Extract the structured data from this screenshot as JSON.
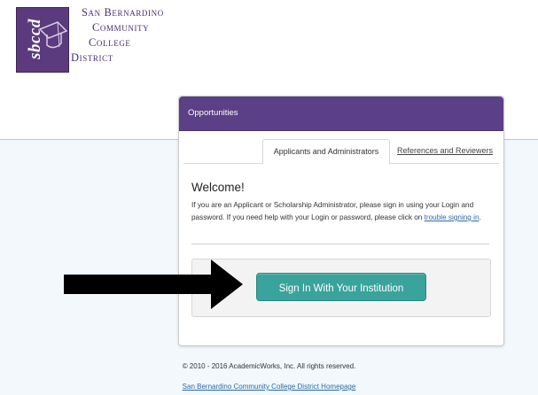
{
  "logo": {
    "monogram": "sbccd",
    "lines": [
      "San Bernardino",
      "Community",
      "College",
      "District"
    ]
  },
  "card": {
    "header": "Opportunities",
    "tabs": [
      {
        "label": "Applicants and Administrators",
        "active": true
      },
      {
        "label": "References and Reviewers",
        "active": false
      }
    ],
    "welcome": "Welcome!",
    "description_before": "If you are an Applicant or Scholarship Administrator, please sign in using your Login and password. If you need help with your Login or password, please click on ",
    "description_link": "trouble signing in",
    "description_after": ".",
    "signin_button": "Sign In With Your Institution"
  },
  "annotation": {
    "arrow_icon": "right-arrow-icon",
    "color": "#000000"
  },
  "footer": {
    "copyright": "© 2010 - 2016 AcademicWorks, Inc. All rights reserved.",
    "homepage_link": "San Bernardino Community College District Homepage"
  },
  "colors": {
    "header": "#5b3f87",
    "button": "#3aa39b",
    "link": "#2a6ba8",
    "logo": "#5b3a7e"
  }
}
